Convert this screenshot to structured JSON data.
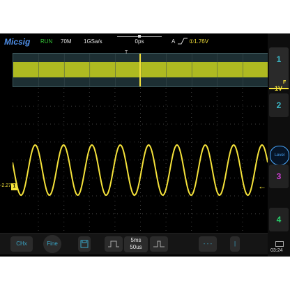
{
  "status": {
    "brand": "Micsig",
    "run_state": "RUN",
    "bandwidth": "70M",
    "sample_rate": "1GSa/s",
    "time_offset": "0ps",
    "trigger_mode": "A",
    "trigger_edge": "rising",
    "trigger_level": "①1.76V"
  },
  "channels": {
    "ch1": {
      "label": "1",
      "volts_div": "1V",
      "coupling": "F",
      "color": "#f5e23a"
    },
    "ch2": {
      "label": "2",
      "color": "#3bb6c5"
    },
    "ch3": {
      "label": "3",
      "color": "#d13fd6"
    },
    "ch4": {
      "label": "4",
      "color": "#27d16b"
    }
  },
  "side": {
    "level_label": "Level"
  },
  "ground_marker": {
    "value": "-2.27",
    "channel": "1"
  },
  "toolbar": {
    "ch_label": "CHx",
    "fine_label": "Fine",
    "time_div_main": "5ms",
    "time_div_zoom": "50us"
  },
  "clock": "03:24",
  "colors": {
    "trace": "#f5e23a",
    "accent": "#3bb6c5",
    "brand": "#4f8fe8",
    "run": "#35c437"
  },
  "waveform": {
    "type": "sine",
    "cycles": 9
  }
}
